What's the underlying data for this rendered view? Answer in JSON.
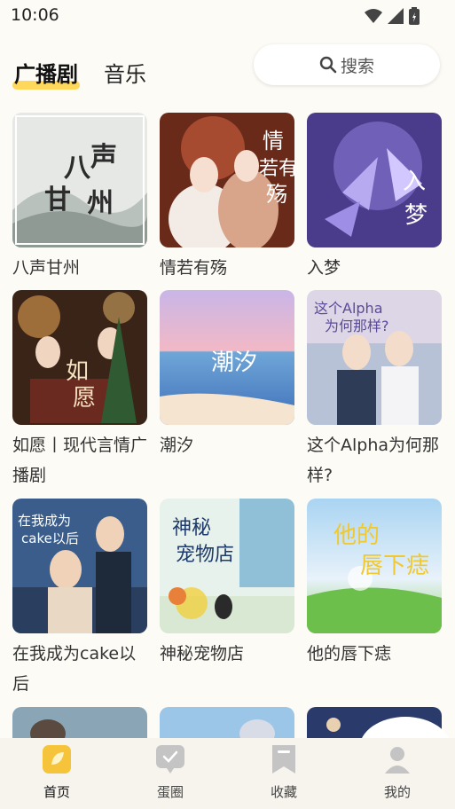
{
  "status": {
    "time": "10:06"
  },
  "header": {
    "tabs": [
      {
        "label": "广播剧"
      },
      {
        "label": "音乐"
      }
    ],
    "search": {
      "label": "搜索"
    }
  },
  "dramas": [
    {
      "title": "八声甘州",
      "cover_text": "八声甘州"
    },
    {
      "title": "情若有殇",
      "cover_text": "情若有殇"
    },
    {
      "title": "入梦",
      "cover_text": "入梦"
    },
    {
      "title": "如愿丨现代言情广播剧",
      "cover_text": "如愿"
    },
    {
      "title": "潮汐",
      "cover_text": "潮汐"
    },
    {
      "title": "这个Alpha为何那样?",
      "cover_text": "这个Alpha为何那样?"
    },
    {
      "title": "在我成为cake以后",
      "cover_text": "在我成为cake以后"
    },
    {
      "title": "神秘宠物店",
      "cover_text": "神秘宠物店"
    },
    {
      "title": "他的唇下痣",
      "cover_text": "他的唇下痣"
    }
  ],
  "nav": {
    "items": [
      {
        "label": "首页",
        "icon": "home-icon",
        "color": "#f5c43a"
      },
      {
        "label": "蛋圈",
        "icon": "chat-icon",
        "color": "#c4c4c4"
      },
      {
        "label": "收藏",
        "icon": "bookmark-icon",
        "color": "#c4c4c4"
      },
      {
        "label": "我的",
        "icon": "profile-icon",
        "color": "#c4c4c4"
      }
    ]
  }
}
